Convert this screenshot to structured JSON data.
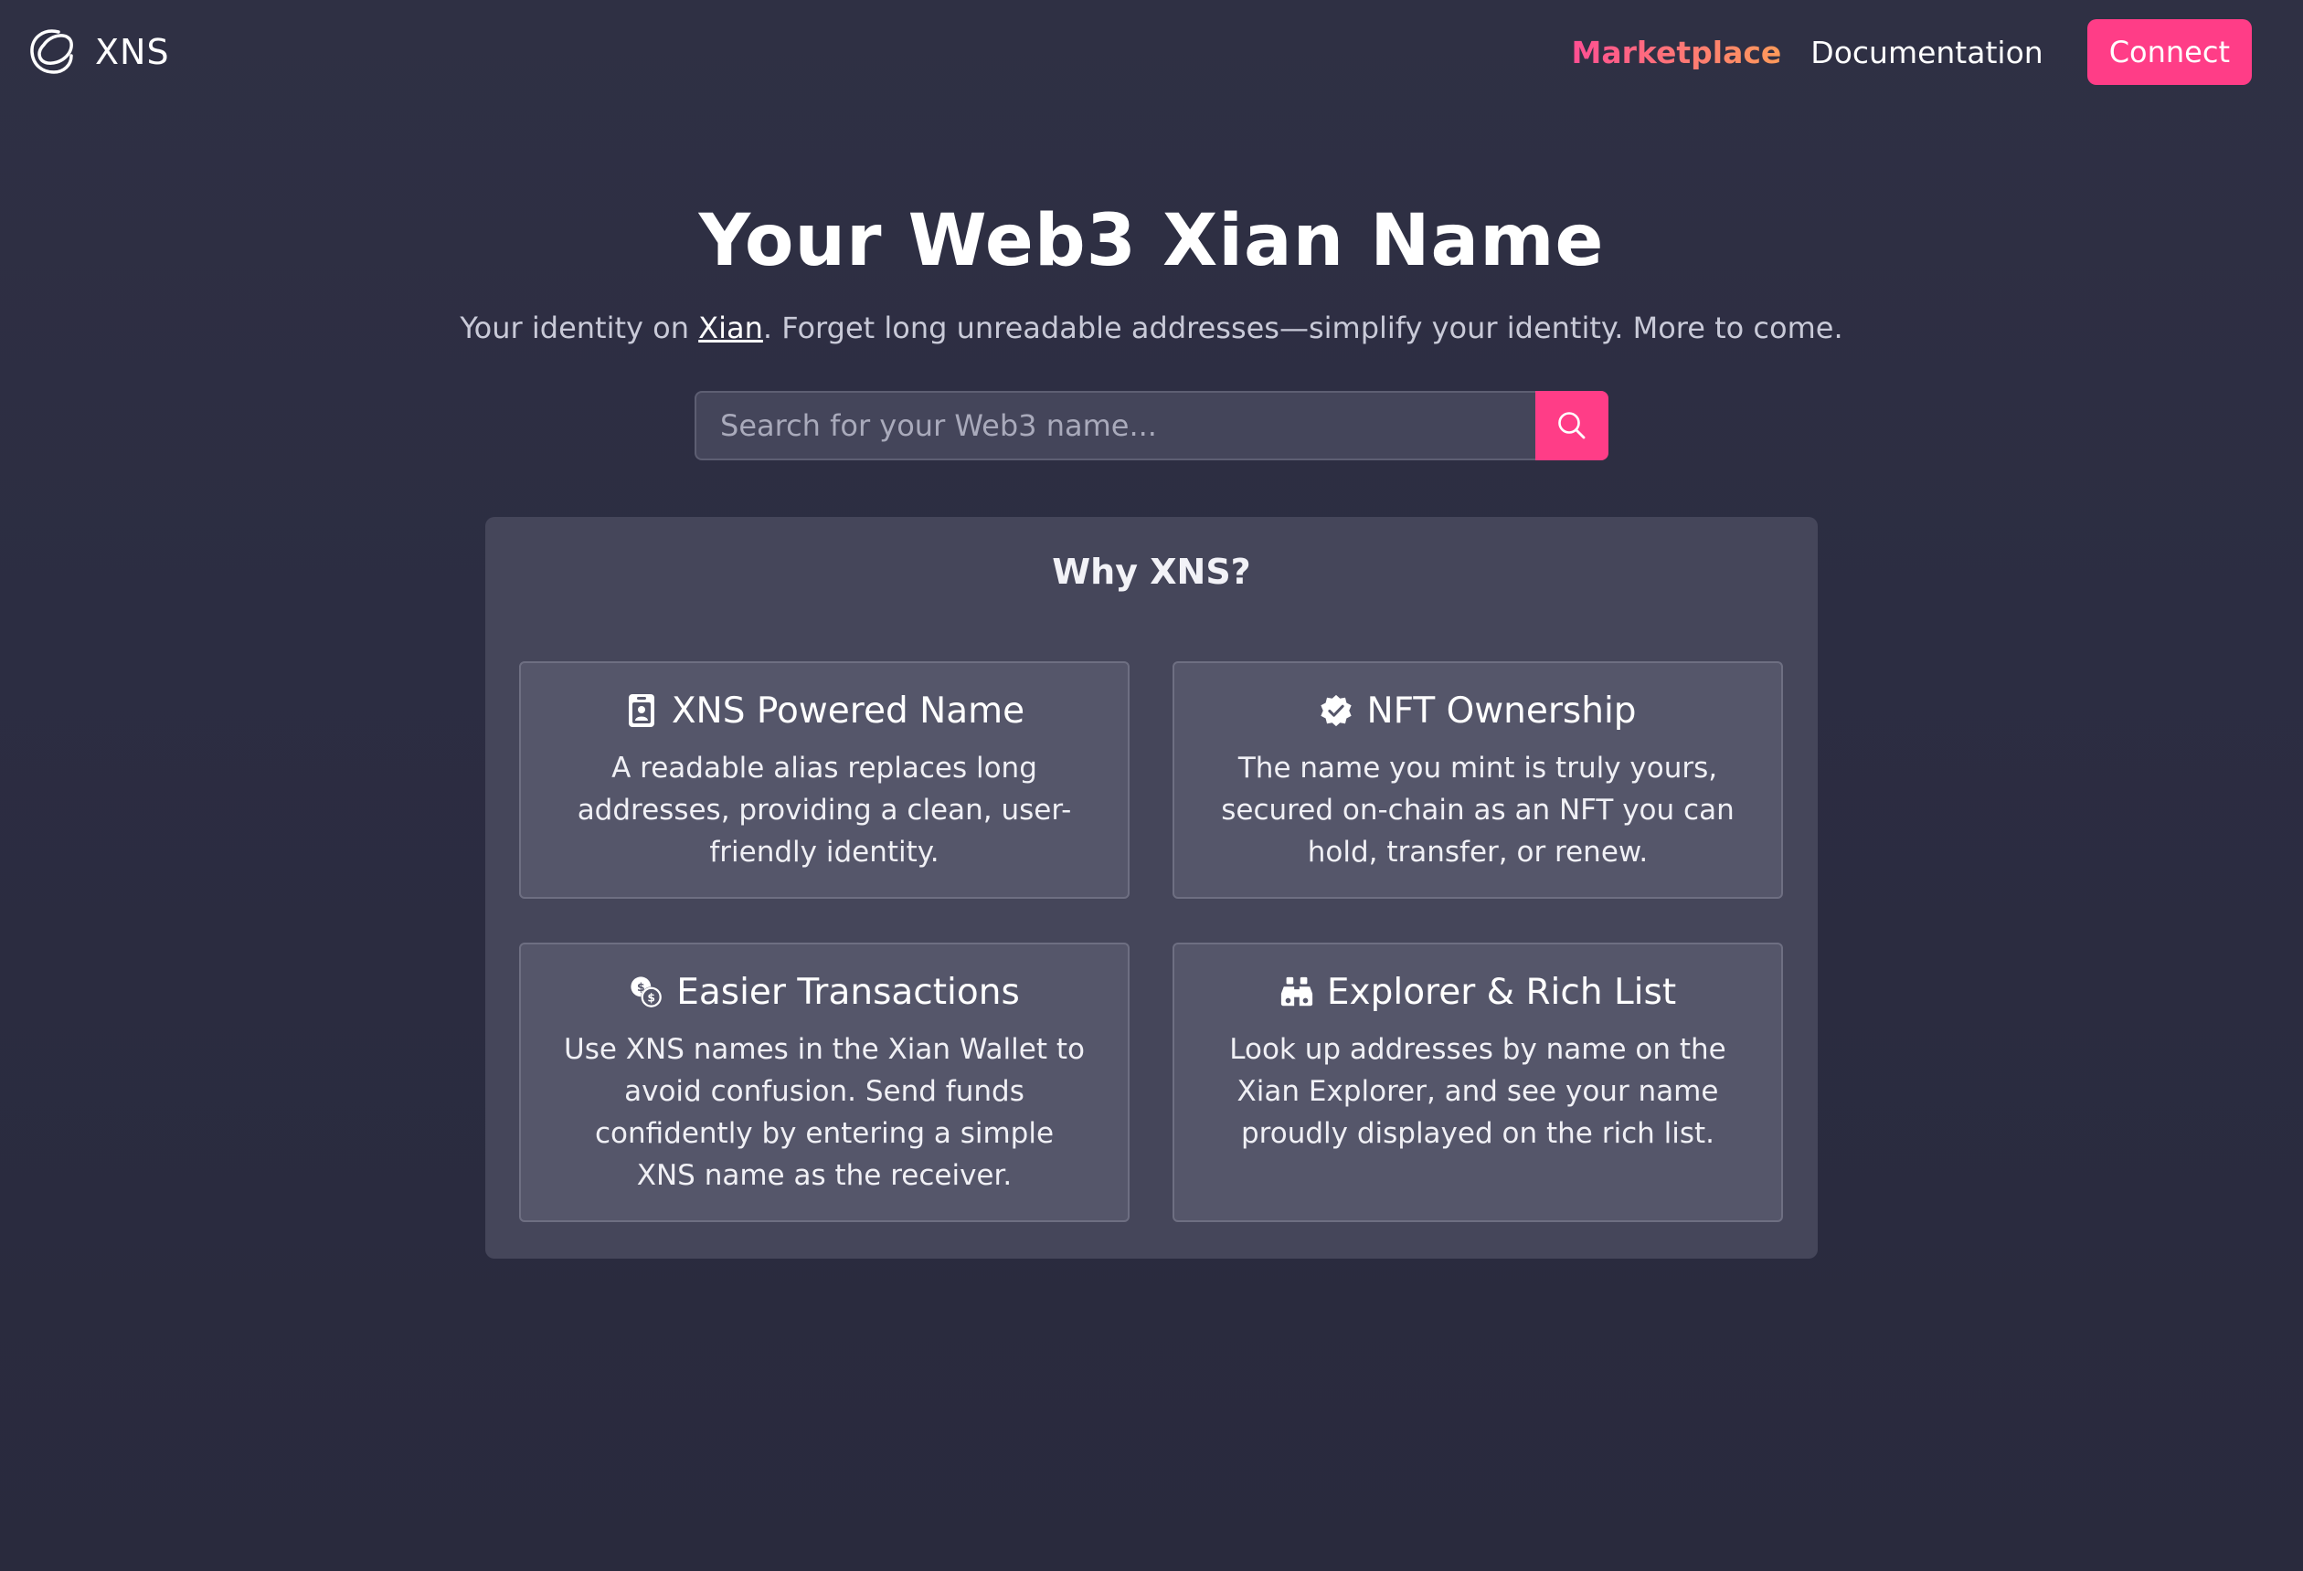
{
  "nav": {
    "brand": "XNS",
    "links": [
      {
        "label": "Marketplace"
      },
      {
        "label": "Documentation"
      }
    ],
    "connect_label": "Connect"
  },
  "hero": {
    "title": "Your Web3 Xian Name",
    "subtitle_prefix": "Your identity on ",
    "subtitle_link": "Xian",
    "subtitle_suffix": ". Forget long unreadable addresses—simplify your identity. More to come."
  },
  "search": {
    "placeholder": "Search for your Web3 name..."
  },
  "why": {
    "title": "Why XNS?",
    "cards": [
      {
        "icon": "id-badge-icon",
        "title": "XNS Powered Name",
        "text": "A readable alias replaces long addresses, providing a clean, user-friendly identity."
      },
      {
        "icon": "verified-badge-icon",
        "title": "NFT Ownership",
        "text": "The name you mint is truly yours, secured on-chain as an NFT you can hold, transfer, or renew."
      },
      {
        "icon": "coins-icon",
        "title": "Easier Transactions",
        "text": "Use XNS names in the Xian Wallet to avoid confusion. Send funds confidently by entering a simple XNS name as the receiver."
      },
      {
        "icon": "binoculars-icon",
        "title": "Explorer & Rich List",
        "text": "Look up addresses by name on the Xian Explorer, and see your name proudly displayed on the rich list."
      }
    ]
  },
  "colors": {
    "accent": "#ff3d87",
    "background": "#2c2d42",
    "panel": "#45465a",
    "card": "#55566a"
  }
}
